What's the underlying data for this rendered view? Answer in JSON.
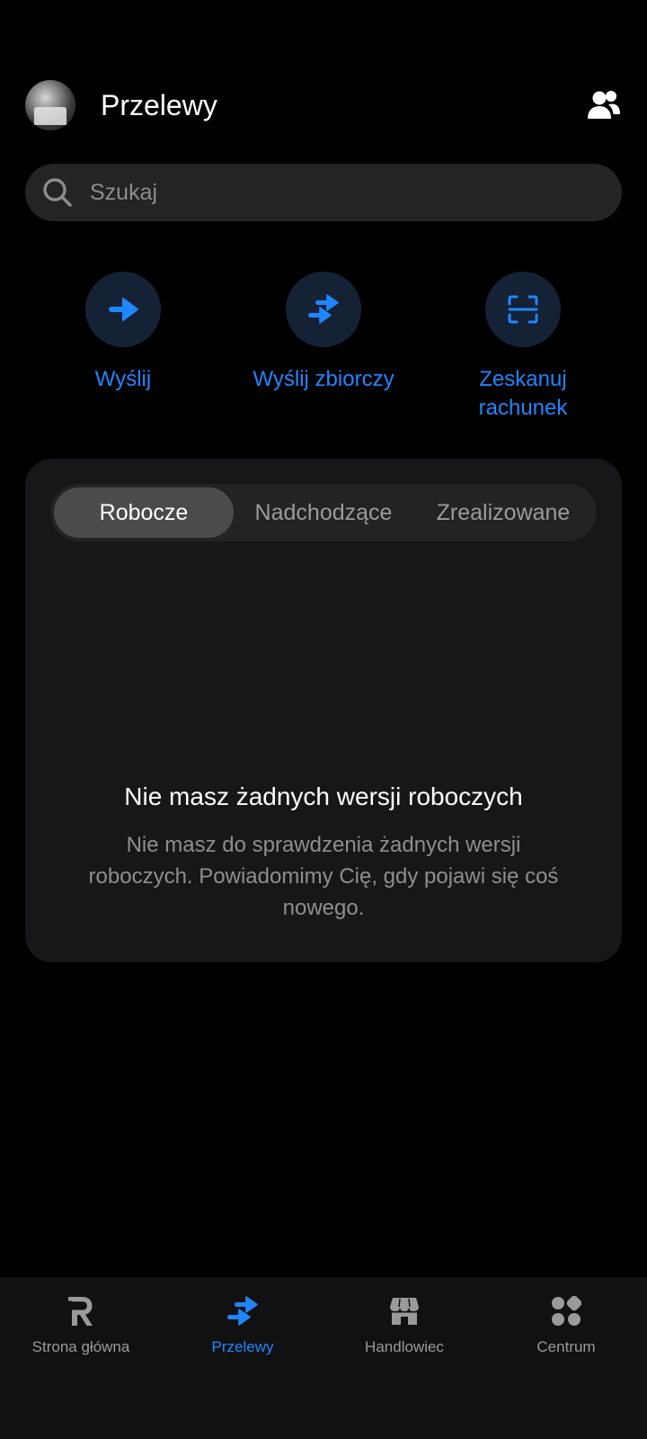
{
  "header": {
    "title": "Przelewy",
    "avatar_icon": "avatar",
    "contacts_icon": "contacts-icon"
  },
  "search": {
    "placeholder": "Szukaj",
    "value": ""
  },
  "actions": [
    {
      "label": "Wyślij",
      "icon": "arrow-right-icon"
    },
    {
      "label": "Wyślij zbiorczy",
      "icon": "bulk-transfer-icon"
    },
    {
      "label": "Zeskanuj rachunek",
      "icon": "scan-icon"
    }
  ],
  "tabs": [
    {
      "label": "Robocze",
      "active": true
    },
    {
      "label": "Nadchodzące",
      "active": false
    },
    {
      "label": "Zrealizowane",
      "active": false
    }
  ],
  "empty_state": {
    "title": "Nie masz żadnych wersji roboczych",
    "description": "Nie masz do sprawdzenia żadnych wersji roboczych. Powiadomimy Cię, gdy pojawi się coś nowego."
  },
  "bottom_nav": [
    {
      "label": "Strona główna",
      "icon": "revolut-logo-icon",
      "active": false
    },
    {
      "label": "Przelewy",
      "icon": "transfers-icon",
      "active": true
    },
    {
      "label": "Handlowiec",
      "icon": "store-icon",
      "active": false
    },
    {
      "label": "Centrum",
      "icon": "grid-icon",
      "active": false
    }
  ],
  "colors": {
    "accent": "#1f86ff",
    "background": "#000000",
    "card": "#171719",
    "action_circle": "#152236"
  }
}
